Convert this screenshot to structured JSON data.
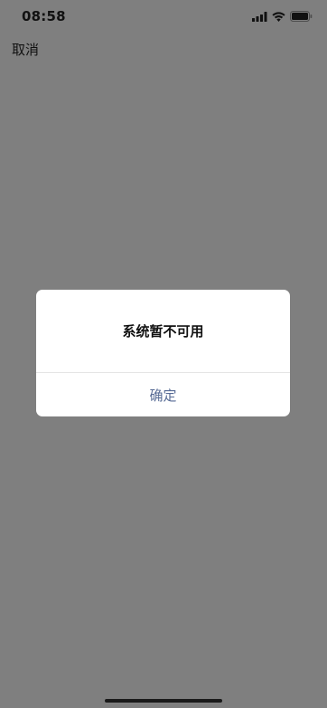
{
  "status_bar": {
    "time": "08:58",
    "icons": [
      "signal-icon",
      "wifi-icon",
      "battery-icon"
    ]
  },
  "nav": {
    "cancel_label": "取消"
  },
  "dialog": {
    "message": "系统暂不可用",
    "confirm_label": "确定"
  },
  "colors": {
    "backdrop": "#7f7f7f",
    "dialog_bg": "#ffffff",
    "confirm_text": "#576b95"
  }
}
